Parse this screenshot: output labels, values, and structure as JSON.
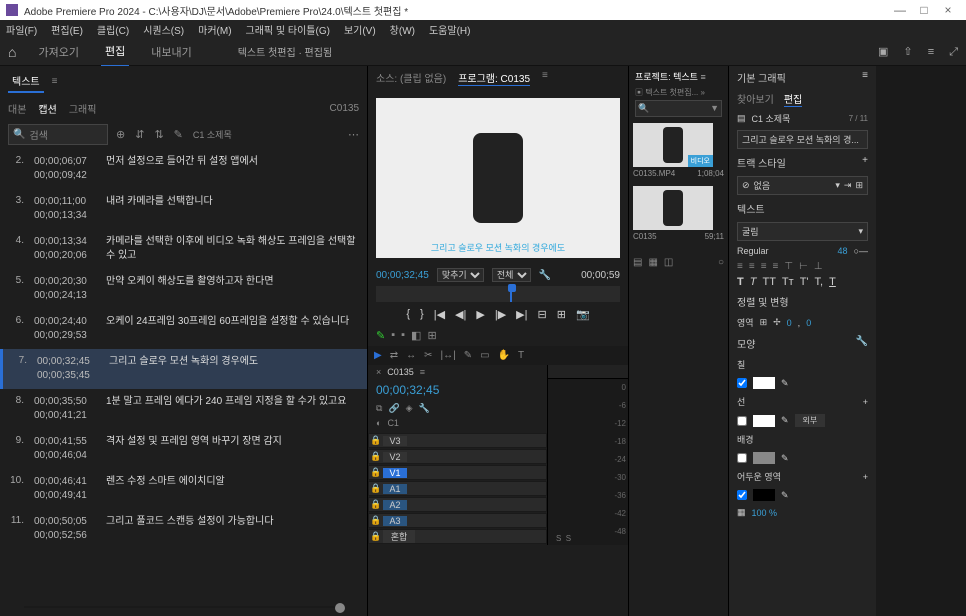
{
  "titlebar": {
    "title": "Adobe Premiere Pro 2024 - C:\\사용자\\DJ\\문서\\Adobe\\Premiere Pro\\24.0\\텍스트 첫편집 *"
  },
  "menu": [
    "파일(F)",
    "편집(E)",
    "클립(C)",
    "시퀀스(S)",
    "마커(M)",
    "그래픽 및 타이틀(G)",
    "보기(V)",
    "창(W)",
    "도움말(H)"
  ],
  "workspace": {
    "tabs": [
      "가져오기",
      "편집",
      "내보내기"
    ],
    "active": 1,
    "file_tab": "텍스트 첫편집 · 편집됨"
  },
  "text_panel": {
    "title": "텍스트",
    "tabs": [
      "대본",
      "캡션",
      "그래픽"
    ],
    "active": 1,
    "clip": "C0135",
    "search_placeholder": "검색",
    "subtitle_label": "C1 소제목",
    "items": [
      {
        "n": "2.",
        "t1": "00;00;06;07",
        "t2": "00;00;09;42",
        "txt": "먼저 설정으로 들어간 뒤 설정 앱에서"
      },
      {
        "n": "3.",
        "t1": "00;00;11;00",
        "t2": "00;00;13;34",
        "txt": "내려 카메라를 선택합니다"
      },
      {
        "n": "4.",
        "t1": "00;00;13;34",
        "t2": "00;00;20;06",
        "txt": "카메라를 선택한 이후에 비디오 녹화 해상도 프레임을 선택할 수 있고"
      },
      {
        "n": "5.",
        "t1": "00;00;20;30",
        "t2": "00;00;24;13",
        "txt": "만약 오케이 해상도를 촬영하고자 한다면"
      },
      {
        "n": "6.",
        "t1": "00;00;24;40",
        "t2": "00;00;29;53",
        "txt": "오케이 24프레임 30프레임 60프레임을 설정할 수 있습니다"
      },
      {
        "n": "7.",
        "t1": "00;00;32;45",
        "t2": "00;00;35;45",
        "txt": "그리고 슬로우 모션 녹화의 경우에도"
      },
      {
        "n": "8.",
        "t1": "00;00;35;50",
        "t2": "00;00;41;21",
        "txt": "1분 말고 프레임 에다가 240 프레임 지정을 할 수가 있고요"
      },
      {
        "n": "9.",
        "t1": "00;00;41;55",
        "t2": "00;00;46;04",
        "txt": "격자 설정 및 프레임 영역 바꾸기 장면 감지"
      },
      {
        "n": "10.",
        "t1": "00;00;46;41",
        "t2": "00;00;49;41",
        "txt": "렌즈 수정 스마트 에이치디알"
      },
      {
        "n": "11.",
        "t1": "00;00;50;05",
        "t2": "00;00;52;56",
        "txt": "그리고 풀코드 스캔등 설정이 가능합니다"
      }
    ],
    "selected": 5
  },
  "source": {
    "tabs": [
      "소스: (클립 없음)",
      "프로그램: C0135"
    ],
    "caption_overlay": "그리고 슬로우 모션 녹화의 경우에도",
    "tc_left": "00;00;32;45",
    "fit": "맞추기",
    "full": "전체",
    "tc_right": "00;00;59"
  },
  "timeline": {
    "name": "C0135",
    "tc": "00;00;32;45",
    "tracks_v": [
      "V3",
      "V2",
      "V1"
    ],
    "tracks_a": [
      "A1",
      "A2",
      "A3"
    ],
    "mix": "혼합",
    "c1": "C1",
    "db_marks": [
      "0",
      "-6",
      "-12",
      "-18",
      "-24",
      "-30",
      "-36",
      "-42",
      "-48"
    ],
    "scale": [
      "S",
      "S"
    ]
  },
  "project": {
    "title": "프로젝트: 텍스트",
    "sub": "텍스트 첫편집...",
    "items": [
      {
        "name": "C0135.MP4",
        "dur": "1;08;04",
        "badge": "비디오"
      },
      {
        "name": "C0135",
        "dur": "59;11",
        "badge": ""
      }
    ]
  },
  "eg": {
    "title": "기본 그래픽",
    "tabs": [
      "찾아보기",
      "편집"
    ],
    "layer": "C1 소제목",
    "count": "7 / 11",
    "text_preview": "그리고 슬로우 모션 녹화의 경...",
    "track_style": "트랙 스타일",
    "none": "없음",
    "text_section": "텍스트",
    "font": "굴림",
    "weight": "Regular",
    "size": "48",
    "align_section": "정렬 및 변형",
    "region": "영역",
    "pos_x": "0",
    "pos_y": "0",
    "appearance": "모양",
    "fill": "칠",
    "stroke": "선",
    "bg": "배경",
    "shadow": "어두운 영역",
    "opacity": "100 %"
  }
}
